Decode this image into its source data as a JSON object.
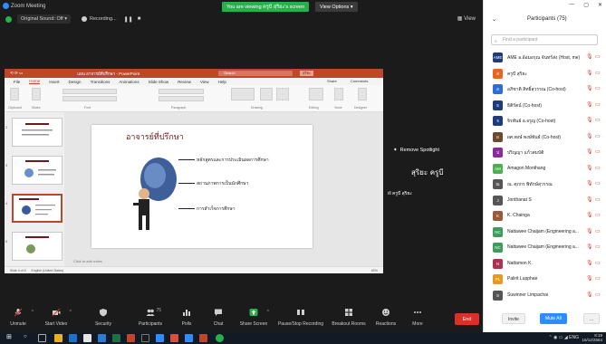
{
  "window": {
    "title": "Zoom Meeting"
  },
  "banner": {
    "viewing": "You are viewing ครูบี สุริยะ's screen",
    "view_options": "View Options ▾"
  },
  "infobar": {
    "original_sound": "Original Sound: Off ▾",
    "recording": "Recording...",
    "pause": "❚❚",
    "stop": "■",
    "view": "▦ View"
  },
  "ppt": {
    "title_file": "แผน อาจารย์ที่ปรึกษา - PowerPoint",
    "search": "Search",
    "user": "สุริยะ",
    "menu": [
      "File",
      "Home",
      "Insert",
      "Design",
      "Transitions",
      "Animations",
      "Slide Show",
      "Review",
      "View",
      "Help"
    ],
    "share": "Share",
    "comments": "Comments",
    "ribbon_groups": [
      "Clipboard",
      "Slides",
      "Font",
      "Paragraph",
      "Drawing",
      "Editing",
      "Voice",
      "Designer"
    ],
    "slide_title": "อาจารย์ที่ปรึกษา",
    "bullets": [
      "หลักสูตรและการประเมินผลการศึกษา",
      "สถานภาพการเป็นนักศึกษา",
      "การสำเร็จการศึกษา"
    ],
    "thumb_numbers": [
      "2",
      "3",
      "4",
      "5"
    ],
    "notes": "Click to add notes",
    "status_slide": "Slide 4 of 6",
    "status_lang": "English (United States)",
    "status_zoom": "60%"
  },
  "speaker": {
    "spotlight": "Remove Spotlight",
    "name": "สุริยะ ครูบี",
    "tag": "ครูบี สุริยะ"
  },
  "toolbar": {
    "items": [
      {
        "label": "Unmute",
        "icon": "microphone-icon"
      },
      {
        "label": "Start Video",
        "icon": "video-icon"
      },
      {
        "label": "Security",
        "icon": "shield-icon"
      },
      {
        "label": "Participants",
        "icon": "participants-icon",
        "count": "75"
      },
      {
        "label": "Polls",
        "icon": "polls-icon"
      },
      {
        "label": "Chat",
        "icon": "chat-icon"
      },
      {
        "label": "Share Screen",
        "icon": "share-screen-icon"
      },
      {
        "label": "Pause/Stop Recording",
        "icon": "recording-icon"
      },
      {
        "label": "Breakout Rooms",
        "icon": "breakout-icon"
      },
      {
        "label": "Reactions",
        "icon": "reactions-icon"
      },
      {
        "label": "More",
        "icon": "more-icon"
      }
    ],
    "end": "End"
  },
  "panel": {
    "title": "Participants (75)",
    "search_placeholder": "Find a participant",
    "participants": [
      {
        "name": "AME อ.อ้อมอรุณ จันทร์ส่ง (Host, me)",
        "initials": "AME",
        "color": "#1f3b7a"
      },
      {
        "name": "ครูบี สุริยะ",
        "initials": "ส",
        "color": "#e8651e"
      },
      {
        "name": "อภิชาติ สิทธิ์สุวรรณ (Co-host)",
        "initials": "อ",
        "color": "#2e6fd6"
      },
      {
        "name": "ธิติรัตน์ (Co-host)",
        "initials": "ธ",
        "color": "#1f3b7a"
      },
      {
        "name": "จิรพันธ์ อ.จรูญ (Co-host)",
        "initials": "จ",
        "color": "#1f3b7a"
      },
      {
        "name": "ผศ.พงษ์ พงษ์พันธ์ (Co-host)",
        "initials": "ผ",
        "color": "#6b4a2d"
      },
      {
        "name": "ปริญญา แก้วสมบัติ",
        "initials": "ป",
        "color": "#8a2b9c"
      },
      {
        "name": "Amagon Monthang",
        "initials": "AM",
        "color": "#4caf50"
      },
      {
        "name": "ณ. ศุภกร พิทักษ์สุวรรณ",
        "initials": "ณ",
        "color": "#555555"
      },
      {
        "name": "Jonthanat S",
        "initials": "J",
        "color": "#555555"
      },
      {
        "name": "K. Chainga",
        "initials": "K",
        "color": "#9a5a3a"
      },
      {
        "name": "Nattawee Chaijam (Engineering a...",
        "initials": "NC",
        "color": "#3f9b5a"
      },
      {
        "name": "Nattawee Chaijam (Engineering a...",
        "initials": "NC",
        "color": "#3f9b5a"
      },
      {
        "name": "Nattamon K.",
        "initials": "N",
        "color": "#aa3355"
      },
      {
        "name": "Palirit Lupphae",
        "initials": "PL",
        "color": "#e89a1e"
      },
      {
        "name": "Suwinner Limpachai",
        "initials": "S",
        "color": "#555555"
      }
    ],
    "invite": "Invite",
    "mute_all": "Mute All",
    "more": "..."
  },
  "taskbar": {
    "lang": "ENG",
    "time": "8:19",
    "date": "16/12/2564"
  }
}
